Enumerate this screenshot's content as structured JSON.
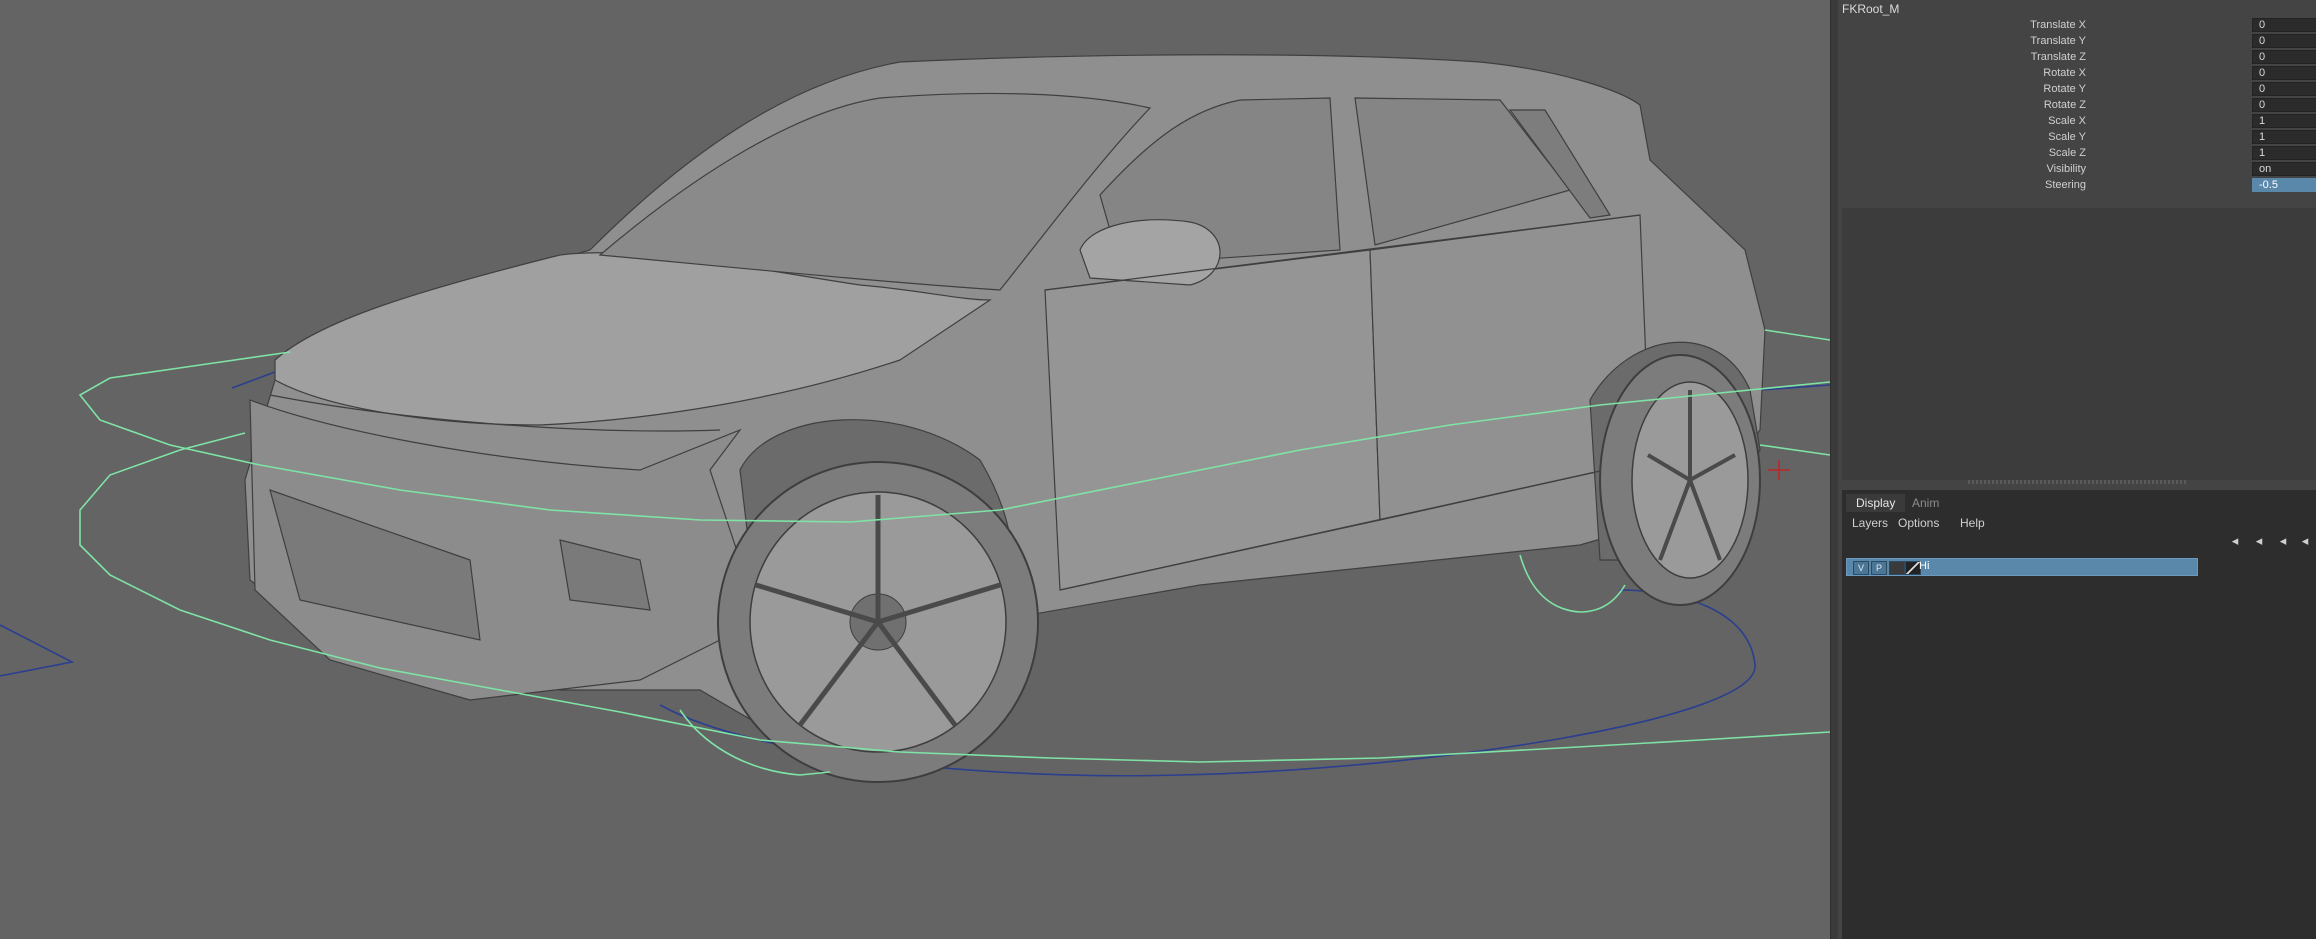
{
  "node": {
    "name": "FKRoot_M"
  },
  "attributes": [
    {
      "label": "Translate X",
      "value": "0"
    },
    {
      "label": "Translate Y",
      "value": "0"
    },
    {
      "label": "Translate Z",
      "value": "0"
    },
    {
      "label": "Rotate X",
      "value": "0"
    },
    {
      "label": "Rotate Y",
      "value": "0"
    },
    {
      "label": "Rotate Z",
      "value": "0"
    },
    {
      "label": "Scale X",
      "value": "1"
    },
    {
      "label": "Scale Y",
      "value": "1"
    },
    {
      "label": "Scale Z",
      "value": "1"
    },
    {
      "label": "Visibility",
      "value": "on"
    },
    {
      "label": "Steering",
      "value": "-0.5"
    }
  ],
  "layer_editor": {
    "tabs": [
      {
        "label": "Display",
        "active": true
      },
      {
        "label": "Anim",
        "active": false
      }
    ],
    "menus": [
      "Layers",
      "Options",
      "Help"
    ],
    "toolbar_icons": [
      "move-layer-up-icon",
      "move-layer-down-icon",
      "new-layer-icon",
      "new-layer-from-selection-icon"
    ],
    "layers": [
      {
        "visible_flag": "V",
        "playback_flag": "P",
        "color": "#3a3a3a",
        "name": "Hi",
        "selected": true
      }
    ]
  },
  "colors": {
    "viewport_bg": "#646464",
    "panel_bg": "#444444",
    "selection": "#5a88ab",
    "control_curve_green": "#7fe3a6",
    "control_curve_blue": "#2a3f8e"
  }
}
